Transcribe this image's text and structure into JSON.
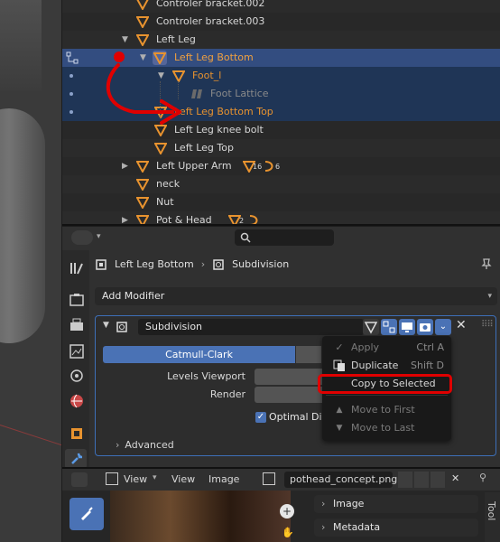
{
  "outliner": {
    "rows": [
      {
        "label": "Controler bracket.002"
      },
      {
        "label": "Controler bracket.003"
      },
      {
        "label": "Left Leg"
      },
      {
        "label": "Left Leg Bottom"
      },
      {
        "label": "Foot_l"
      },
      {
        "label": "Foot Lattice"
      },
      {
        "label": "Left Leg Bottom Top"
      },
      {
        "label": "Left Leg knee bolt"
      },
      {
        "label": "Left Leg Top"
      },
      {
        "label": "Left Upper Arm",
        "badge1": "16",
        "badge2": "6"
      },
      {
        "label": "neck"
      },
      {
        "label": "Nut"
      },
      {
        "label": "Pot & Head",
        "badge1": "2"
      }
    ]
  },
  "properties": {
    "breadcrumb_object": "Left Leg Bottom",
    "breadcrumb_modifier": "Subdivision",
    "add_modifier": "Add Modifier",
    "modifier_name": "Subdivision",
    "mode_catmull": "Catmull-Clark",
    "levels_viewport": "Levels Viewport",
    "render": "Render",
    "optimal_display": "Optimal Dis",
    "advanced": "Advanced"
  },
  "menu": {
    "items": [
      {
        "label": "Apply",
        "shortcut": "Ctrl A"
      },
      {
        "label": "Duplicate",
        "shortcut": "Shift D"
      },
      {
        "label": "Copy to Selected",
        "shortcut": ""
      },
      {
        "label": "Move to First",
        "shortcut": ""
      },
      {
        "label": "Move to Last",
        "shortcut": ""
      }
    ]
  },
  "image_editor": {
    "view_menu": "View",
    "view2": "View",
    "image_menu": "Image",
    "filename": "pothead_concept.png",
    "panel_image": "Image",
    "panel_metadata": "Metadata",
    "tool_tab": "Tool"
  },
  "colors": {
    "selection": "#334d80",
    "orange": "#e8932f",
    "accent_blue": "#4a72b5",
    "highlight_red": "#e00000"
  }
}
